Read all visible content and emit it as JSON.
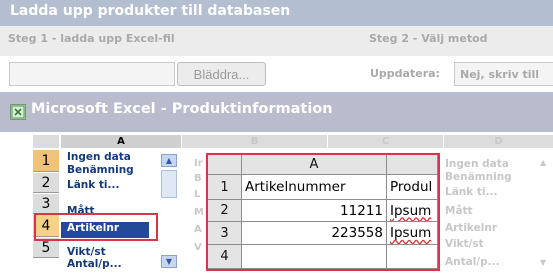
{
  "header": {
    "title": "Ladda upp produkter till databasen"
  },
  "steps": {
    "step1_label": "Steg 1 - ladda upp Excel-fil",
    "step2_label": "Steg 2 - Välj metod",
    "browse_label": "Bläddra...",
    "file_value": "",
    "update_label": "Uppdatera:",
    "update_value": "Nej, skriv till"
  },
  "excel": {
    "title": "Microsoft Excel - Produktinformation",
    "columns": [
      "A",
      "B",
      "C",
      "D"
    ],
    "rows": [
      "1",
      "2",
      "3",
      "4",
      "5"
    ],
    "col_a_values": [
      "Ingen data",
      "Benämning",
      "Länk ti...",
      "Mått",
      "Artikelnr",
      "Vikt/st",
      "Antal/p..."
    ],
    "col_d_values": [
      "Ingen data",
      "Benämning",
      "Länk ti...",
      "Mått",
      "Artikelnr",
      "Vikt/st",
      "Antal/p..."
    ],
    "dim_fragments": [
      "Ir",
      "B",
      "L",
      "M",
      "A",
      "V"
    ],
    "selected_row": "4",
    "selected_value": "Artikelnr"
  },
  "popup": {
    "column_header": "A",
    "row_numbers": [
      "1",
      "2",
      "3",
      "4"
    ],
    "cells_a": [
      "Artikelnummer",
      "11211",
      "223558",
      ""
    ],
    "cells_b": [
      "Produl",
      "Ipsum",
      "Ipsum",
      ""
    ]
  },
  "colors": {
    "header_bar": "#b3bed1",
    "excel_bar": "#b9bccd",
    "highlight_border": "#d9344a",
    "selected_cell": "#234a96",
    "selected_row_header": "#f5d28a"
  }
}
